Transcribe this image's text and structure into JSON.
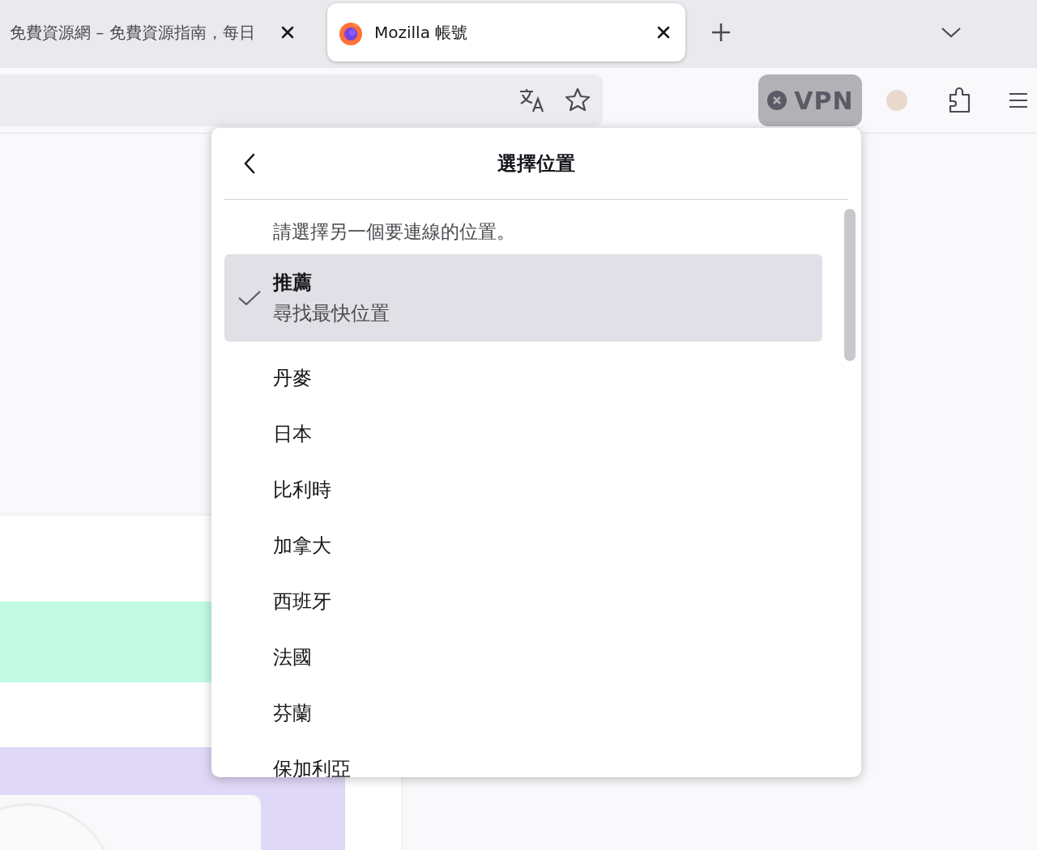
{
  "tabs": [
    {
      "title": "免費資源網 – 免費資源指南，每日",
      "selected": false,
      "has_favicon": false
    },
    {
      "title": "Mozilla 帳號",
      "selected": true,
      "has_favicon": true
    }
  ],
  "toolbar": {
    "vpn": {
      "label": "VPN",
      "connected": false
    }
  },
  "location_panel": {
    "title": "選擇位置",
    "prompt": "請選擇另一個要連線的位置。",
    "locations": [
      {
        "name": "推薦",
        "description": "尋找最快位置",
        "selected": true
      },
      {
        "name": "丹麥",
        "selected": false
      },
      {
        "name": "日本",
        "selected": false
      },
      {
        "name": "比利時",
        "selected": false
      },
      {
        "name": "加拿大",
        "selected": false
      },
      {
        "name": "西班牙",
        "selected": false
      },
      {
        "name": "法國",
        "selected": false
      },
      {
        "name": "芬蘭",
        "selected": false
      },
      {
        "name": "保加利亞",
        "selected": false
      }
    ]
  }
}
